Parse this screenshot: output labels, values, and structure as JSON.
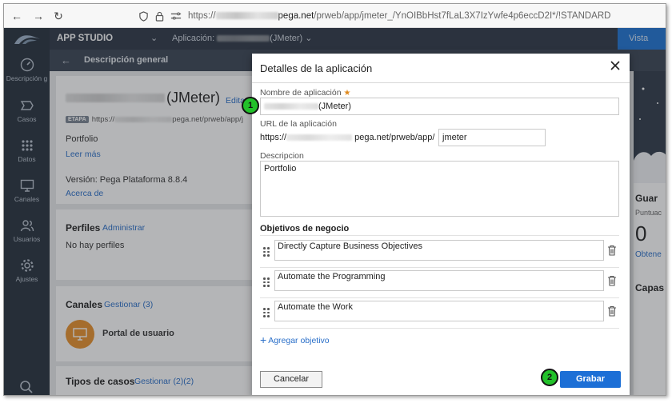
{
  "browser": {
    "url_prefix": "https://",
    "url_host": "pega.net",
    "url_path": "/prweb/app/jmeter_/YnOIBbHst7fLaL3X7IzYwfe4p6eccD2I*/!STANDARD"
  },
  "app_header": {
    "title": "APP STUDIO",
    "application_label": "Aplicación:",
    "application_suffix": "(JMeter)",
    "preview_button": "Vista prev"
  },
  "sidebar": {
    "items": [
      {
        "label": "Descripción g",
        "icon": "gauge-icon"
      },
      {
        "label": "Casos",
        "icon": "cases-icon"
      },
      {
        "label": "Datos",
        "icon": "data-grid-icon"
      },
      {
        "label": "Canales",
        "icon": "channels-icon"
      },
      {
        "label": "Usuarios",
        "icon": "users-icon"
      },
      {
        "label": "Ajustes",
        "icon": "settings-icon"
      }
    ],
    "search_icon": "search-icon"
  },
  "page": {
    "subheader_title": "Descripción general",
    "app_name": "(JMeter)",
    "edit_link": "Editar",
    "stage_badge": "ETAPA",
    "stage_url_prefix": "https://",
    "stage_url_rest": "pega.net/prweb/app/j",
    "description": "Portfolio",
    "read_more": "Leer más",
    "version": "Versión: Pega Plataforma 8.8.4",
    "about_link": "Acerca de",
    "profiles_title": "Perfiles",
    "profiles_link": "Administrar",
    "profiles_empty": "No hay perfiles",
    "channels_title": "Canales",
    "channels_link": "Gestionar (3)",
    "channel_item": "Portal de usuario",
    "case_types_title": "Tipos de casos",
    "case_types_link": "Gestionar (2)(2)",
    "right_panel_title": "Guar",
    "right_panel_sub": "Puntuac",
    "right_panel_value": "0",
    "right_panel_link": "Obtene",
    "right_panel_cap": "Capas"
  },
  "modal": {
    "title": "Detalles de la aplicación",
    "name_label": "Nombre de aplicación",
    "name_value_suffix": "(JMeter)",
    "url_label": "URL de la aplicación",
    "url_prefix": "https://",
    "url_middle": "pega.net/prweb/app/",
    "url_value": "jmeter",
    "description_label": "Descripcion",
    "description_value": "Portfolio",
    "objectives_title": "Objetivos de negocio",
    "objectives": [
      "Directly Capture Business Objectives",
      "Automate the Programming",
      "Automate the Work"
    ],
    "add_objective": "Agregar objetivo",
    "cancel_button": "Cancelar",
    "save_button": "Grabar"
  },
  "annotations": {
    "step1": "1",
    "step2": "2"
  },
  "colors": {
    "app_header": "#2d3746",
    "sidebar": "#25303d",
    "primary": "#1c6fd6",
    "link": "#2a6fc9",
    "step_marker": "#22c12a"
  }
}
